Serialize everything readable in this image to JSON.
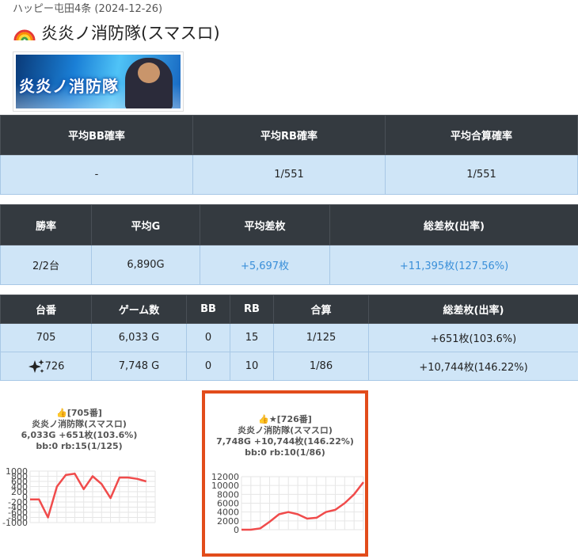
{
  "header": {
    "breadcrumb": "ハッピー屯田4条 (2024-12-26)",
    "title": "炎炎ノ消防隊(スマスロ)",
    "banner_text": "炎炎ノ消防隊"
  },
  "summary_rates": {
    "headers": [
      "平均BB確率",
      "平均RB確率",
      "平均合算確率"
    ],
    "values": [
      "-",
      "1/551",
      "1/551"
    ]
  },
  "summary_results": {
    "headers": [
      "勝率",
      "平均G",
      "平均差枚",
      "総差枚(出率)"
    ],
    "values": [
      "2/2台",
      "6,890G",
      "+5,697枚",
      "+11,395枚(127.56%)"
    ]
  },
  "machines": {
    "headers": [
      "台番",
      "ゲーム数",
      "BB",
      "RB",
      "合算",
      "総差枚(出率)"
    ],
    "rows": [
      {
        "id": "705",
        "games": "6,033 G",
        "bb": "0",
        "rb": "15",
        "combined": "1/125",
        "diff": "+651枚(103.6%)",
        "special": false
      },
      {
        "id": "726",
        "games": "7,748 G",
        "bb": "0",
        "rb": "10",
        "combined": "1/86",
        "diff": "+10,744枚(146.22%)",
        "special": true
      }
    ]
  },
  "colors": {
    "header_bg": "#343a40",
    "cell_bg": "#cfe5f7",
    "positive_blue": "#3a8fd9",
    "line_red": "#f04b4b",
    "highlight_border": "#e24c1b"
  },
  "chart_data": [
    {
      "type": "line",
      "title_lines": [
        "👍[705番]",
        "炎炎ノ消防隊(スマスロ)",
        "6,033G +651枚(103.6%)",
        "bb:0 rb:15(1/125)"
      ],
      "x": [
        0,
        1,
        2,
        3,
        4,
        5,
        6,
        7,
        8,
        9,
        10,
        11,
        12,
        13,
        14
      ],
      "values": [
        -100,
        -100,
        -800,
        400,
        850,
        900,
        300,
        800,
        500,
        -50,
        750,
        750,
        700,
        600,
        null
      ],
      "yticks": [
        1000,
        800,
        600,
        400,
        200,
        0,
        -200,
        -400,
        -600,
        -800,
        -1000
      ],
      "ylim": [
        -1000,
        1000
      ],
      "grid": true,
      "color": "#f04b4b"
    },
    {
      "type": "line",
      "title_lines": [
        "👍★[726番]",
        "炎炎ノ消防隊(スマスロ)",
        "7,748G +10,744枚(146.22%)",
        "bb:0 rb:10(1/86)"
      ],
      "x": [
        0,
        1,
        2,
        3,
        4,
        5,
        6,
        7,
        8,
        9,
        10,
        11,
        12,
        13
      ],
      "values": [
        0,
        0,
        300,
        1800,
        3500,
        4000,
        3500,
        2500,
        2700,
        4000,
        4500,
        6000,
        8000,
        10744
      ],
      "yticks": [
        12000,
        10000,
        8000,
        6000,
        4000,
        2000,
        0
      ],
      "ylim": [
        0,
        12000
      ],
      "grid": true,
      "color": "#f04b4b"
    }
  ]
}
